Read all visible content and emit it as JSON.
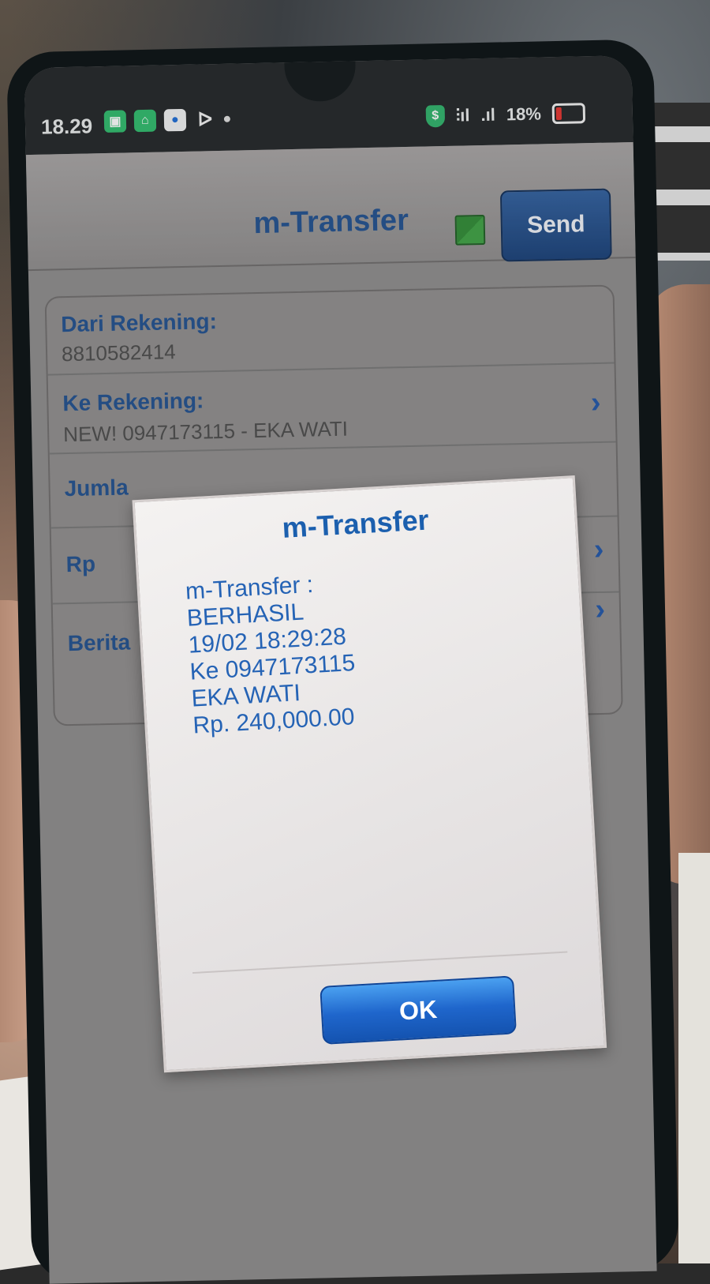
{
  "status_bar": {
    "time": "18.29",
    "battery": "18%",
    "icons": [
      "app-green-icon",
      "app-green-icon",
      "app-blue-icon",
      "kite-icon",
      "shield-dollar-icon",
      "signal-icon",
      "battery-icon"
    ]
  },
  "header": {
    "title": "m-Transfer",
    "send_label": "Send",
    "accent": "#1f4f8f"
  },
  "form": {
    "from": {
      "label": "Dari Rekening:",
      "value": "8810582414"
    },
    "to": {
      "label": "Ke Rekening:",
      "value": "NEW! 0947173115 - EKA WATI"
    },
    "amount_label": "Jumla",
    "currency_label": "Rp",
    "message_label": "Berita"
  },
  "dialog": {
    "title": "m-Transfer",
    "lines": [
      "m-Transfer :",
      "BERHASIL",
      "19/02 18:29:28",
      "Ke 0947173115",
      "EKA WATI",
      "Rp. 240,000.00"
    ],
    "ok_label": "OK",
    "button_color": "#1f66cc"
  }
}
